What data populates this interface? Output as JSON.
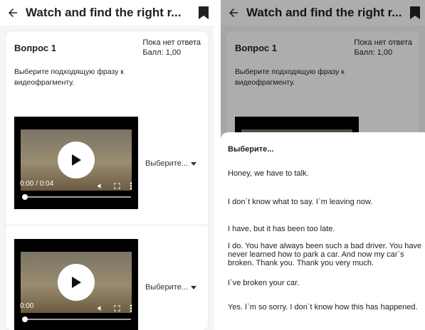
{
  "left": {
    "appbar": {
      "title": "Watch and find the right r..."
    },
    "question": {
      "title": "Вопрос 1",
      "status": "Пока нет ответа",
      "score": "Балл: 1,00",
      "text": "Выберите подходящую фразу к видеофрагменту."
    },
    "videos": [
      {
        "time": "0:00 / 0:04",
        "select_label": "Выберите..."
      },
      {
        "time": "0:00",
        "select_label": "Выберите..."
      }
    ]
  },
  "right": {
    "appbar": {
      "title": "Watch and find the right r..."
    },
    "question": {
      "title": "Вопрос 1",
      "status": "Пока нет ответа",
      "score": "Балл: 1,00",
      "text": "Выберите подходящую фразу к видеофрагменту."
    },
    "sheet": {
      "title": "Выберите...",
      "options": [
        "Honey, we have to talk.",
        "I don`t know what to say. I`m leaving now.",
        "I have, but it has been too late.",
        "I do. You have always been such a bad driver. You have never learned how to park a car. And now my car`s broken. Thank you. Thank you very much.",
        "I`ve broken your car.",
        "Yes. I`m so sorry. I don`t know how this has happened."
      ]
    }
  },
  "colors": {
    "overlay": "#000000",
    "sheet_bg": "#ffffff",
    "video_bg": "#000000"
  },
  "icons": [
    "back-arrow-icon",
    "bookmark-icon",
    "play-icon",
    "volume-icon",
    "fullscreen-icon",
    "more-vert-icon",
    "dropdown-arrow-icon"
  ]
}
